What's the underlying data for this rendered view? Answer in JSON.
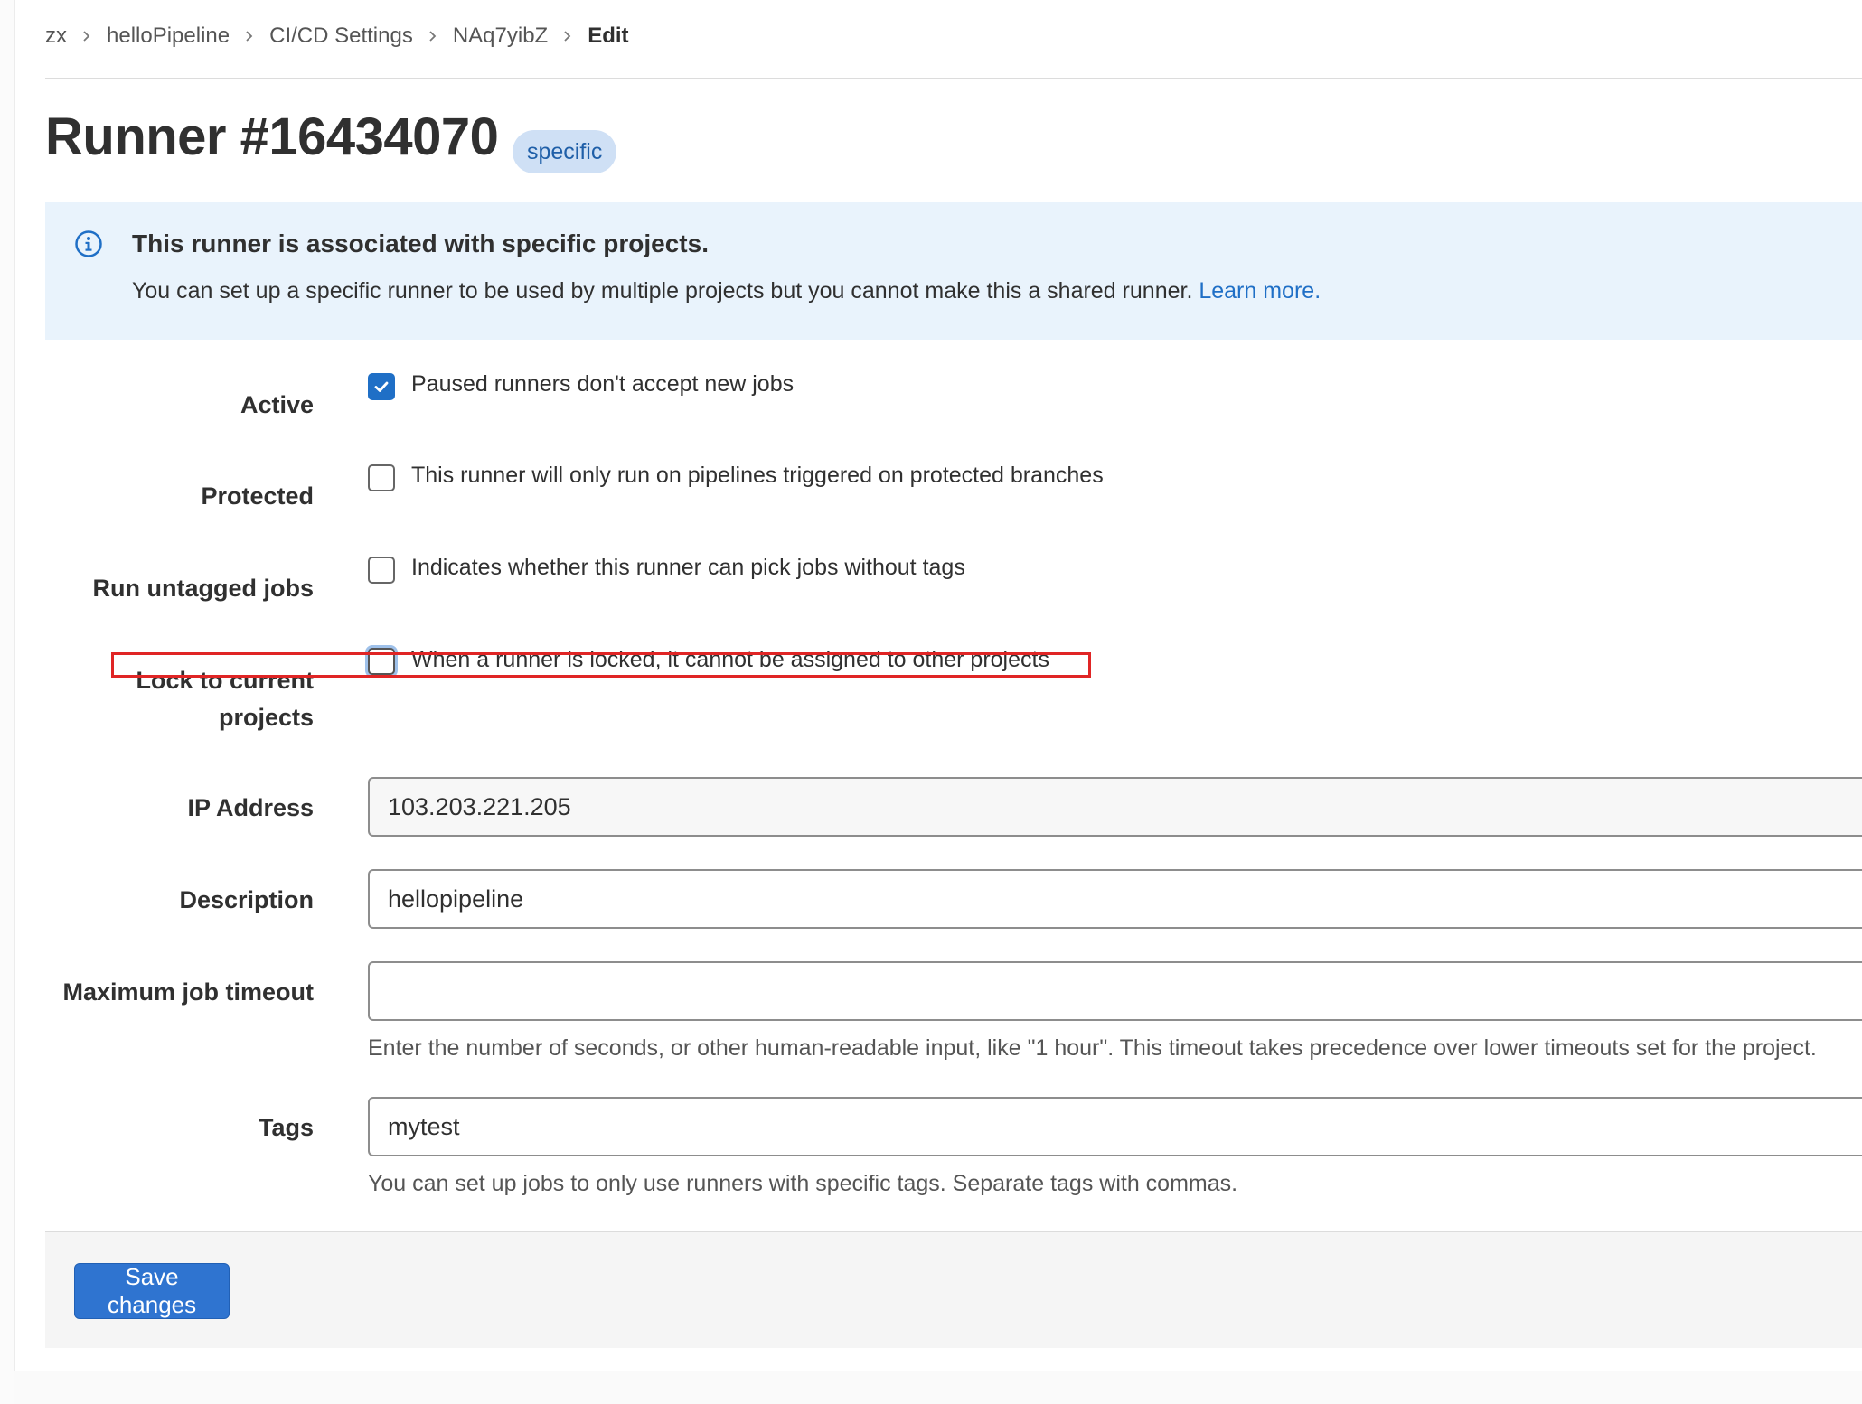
{
  "breadcrumb": {
    "items": [
      "zx",
      "helloPipeline",
      "CI/CD Settings",
      "NAq7yibZ"
    ],
    "current": "Edit"
  },
  "page": {
    "title": "Runner #16434070",
    "badge": "specific"
  },
  "alert": {
    "title": "This runner is associated with specific projects.",
    "body": "You can set up a specific runner to be used by multiple projects but you cannot make this a shared runner.",
    "link": "Learn more."
  },
  "form": {
    "active": {
      "label": "Active",
      "text": "Paused runners don't accept new jobs",
      "checked": true
    },
    "protected": {
      "label": "Protected",
      "text": "This runner will only run on pipelines triggered on protected branches",
      "checked": false
    },
    "untagged": {
      "label": "Run untagged jobs",
      "text": "Indicates whether this runner can pick jobs without tags",
      "checked": false
    },
    "locked": {
      "label_line1": "Lock to current",
      "label_line2": "projects",
      "text": "When a runner is locked, it cannot be assigned to other projects",
      "checked": false
    },
    "ip": {
      "label": "IP Address",
      "value": "103.203.221.205"
    },
    "description": {
      "label": "Description",
      "value": "hellopipeline"
    },
    "timeout": {
      "label": "Maximum job timeout",
      "value": "",
      "help": "Enter the number of seconds, or other human-readable input, like \"1 hour\". This timeout takes precedence over lower timeouts set for the project."
    },
    "tags": {
      "label": "Tags",
      "value": "mytest",
      "help": "You can set up jobs to only use runners with specific tags. Separate tags with commas."
    }
  },
  "footer": {
    "save_label": "Save changes"
  },
  "colors": {
    "accent": "#1f6fc6",
    "alert_bg": "#e9f3fc",
    "annotation": "#e02525"
  },
  "icons": {
    "alert": "info-icon",
    "separator": "chevron-right-icon",
    "checkmark": "check-icon"
  }
}
